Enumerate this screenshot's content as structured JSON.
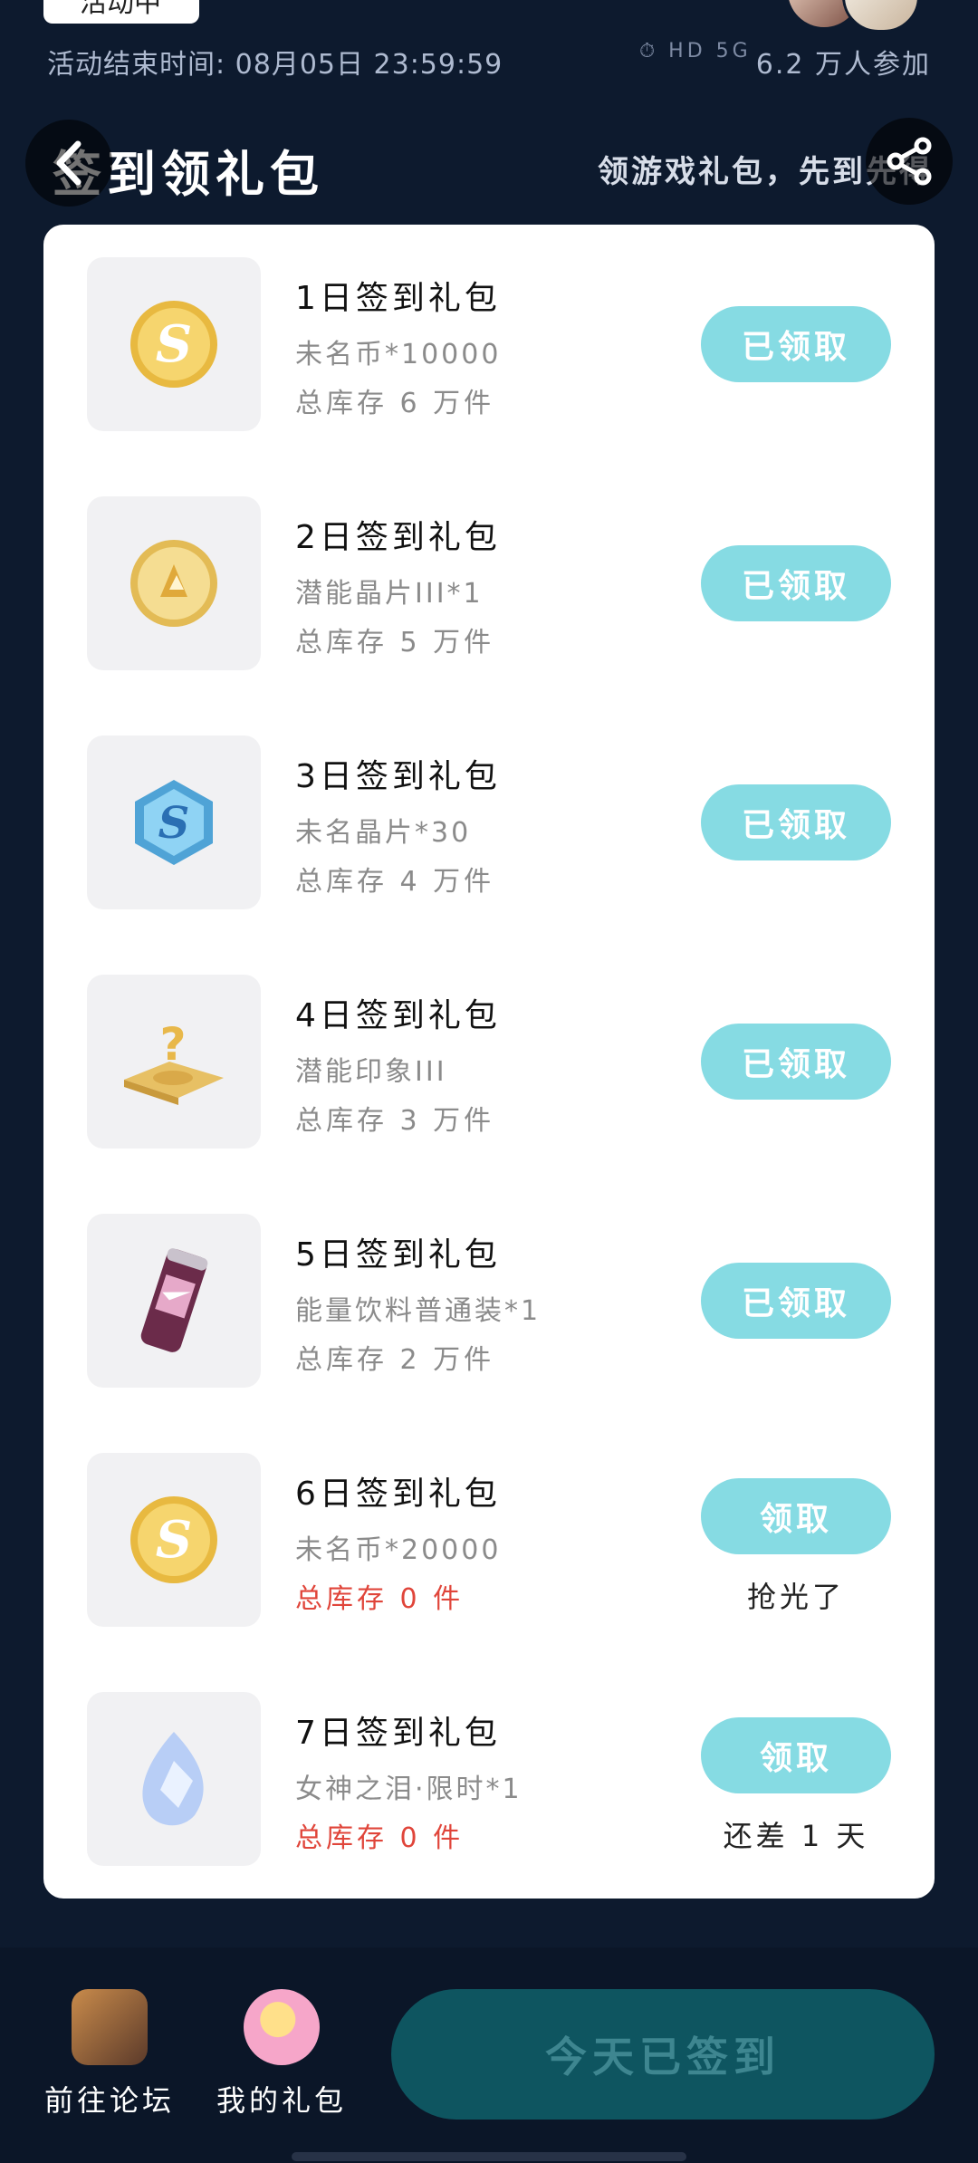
{
  "top": {
    "chip_text": "活动中",
    "end_time": "活动结束时间: 08月05日 23:59:59",
    "status_icons": "⏱ HD 5G",
    "participants": "6.2 万人参加"
  },
  "header": {
    "title": "签到领礼包",
    "subtitle": "领游戏礼包，先到先得"
  },
  "items": [
    {
      "title": "1日签到礼包",
      "desc": "未名币*10000",
      "stock": "总库存 6 万件",
      "button": "已领取",
      "note": ""
    },
    {
      "title": "2日签到礼包",
      "desc": "潜能晶片III*1",
      "stock": "总库存 5 万件",
      "button": "已领取",
      "note": ""
    },
    {
      "title": "3日签到礼包",
      "desc": "未名晶片*30",
      "stock": "总库存 4 万件",
      "button": "已领取",
      "note": ""
    },
    {
      "title": "4日签到礼包",
      "desc": "潜能印象III",
      "stock": "总库存 3 万件",
      "button": "已领取",
      "note": ""
    },
    {
      "title": "5日签到礼包",
      "desc": "能量饮料普通装*1",
      "stock": "总库存 2 万件",
      "button": "已领取",
      "note": ""
    },
    {
      "title": "6日签到礼包",
      "desc": "未名币*20000",
      "stock": "总库存 0 件",
      "button": "领取",
      "note": "抢光了"
    },
    {
      "title": "7日签到礼包",
      "desc": "女神之泪·限时*1",
      "stock": "总库存 0 件",
      "button": "领取",
      "note": "还差 1 天"
    }
  ],
  "bottom": {
    "forum_label": "前往论坛",
    "gifts_label": "我的礼包",
    "signed_label": "今天已签到"
  },
  "colors": {
    "background": "#0d1a2e",
    "button": "#86dbe3",
    "stock_zero": "#e0453a",
    "signed_button": "#0e5560"
  }
}
